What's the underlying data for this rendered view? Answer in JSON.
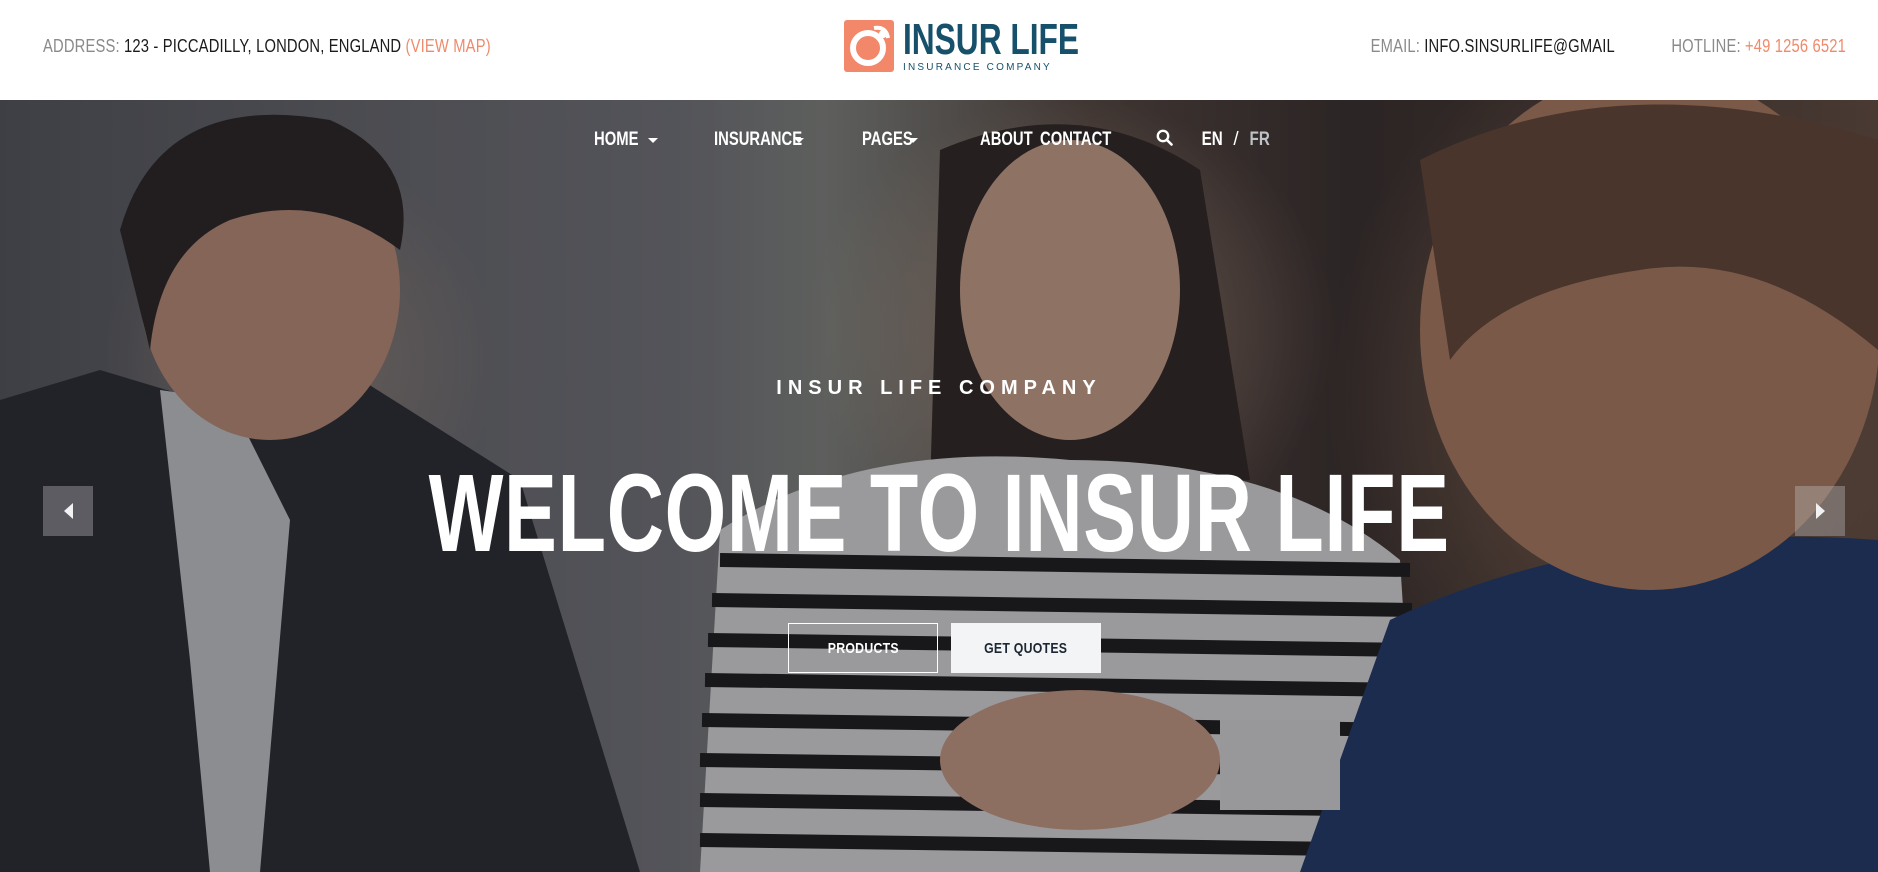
{
  "topbar": {
    "address_label": "ADDRESS:",
    "address_value": "123 - PICCADILLY, LONDON, ENGLAND",
    "view_map": "(VIEW MAP)",
    "email_label": "EMAIL:",
    "email_value": "INFO.SINSURLIFE@GMAIL",
    "hotline_label": "HOTLINE:",
    "hotline_value": "+49 1256 6521"
  },
  "logo": {
    "title": "INSUR LIFE",
    "subtitle": "INSURANCE COMPANY",
    "icon": "life-ring-logo-icon"
  },
  "nav": {
    "items": [
      {
        "label": "HOME",
        "dropdown": true
      },
      {
        "label": "INSURANCE",
        "dropdown": true
      },
      {
        "label": "PAGES",
        "dropdown": true
      },
      {
        "label": "ABOUT",
        "dropdown": false
      },
      {
        "label": "CONTACT",
        "dropdown": false
      }
    ],
    "search_icon": "search-icon",
    "lang_en": "EN",
    "lang_sep": "/",
    "lang_fr": "FR"
  },
  "hero": {
    "kicker": "INSUR LIFE COMPANY",
    "headline": "WELCOME TO INSUR LIFE",
    "btn_products": "PRODUCTS",
    "btn_quotes": "GET QUOTES",
    "prev_icon": "arrow-left-icon",
    "next_icon": "arrow-right-icon"
  },
  "colors": {
    "accent": "#f08a6c",
    "brand": "#17506b",
    "text_dark": "#1b1b1b",
    "label_gray": "#8a8a8a"
  }
}
